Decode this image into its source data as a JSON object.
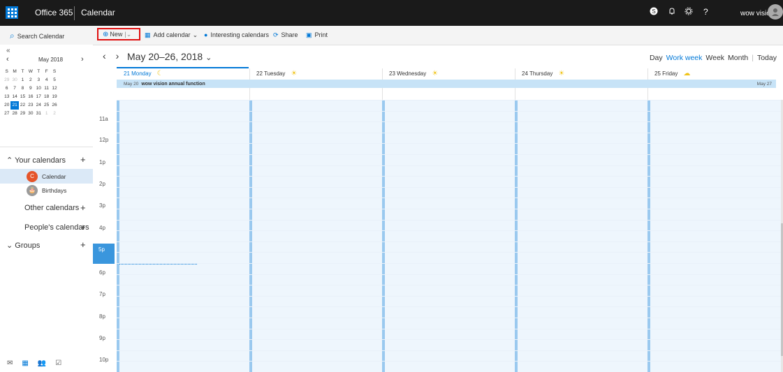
{
  "topbar": {
    "app_name": "Office 365",
    "module_name": "Calendar",
    "icons": [
      "skype-icon",
      "bell-icon",
      "gear-icon",
      "help-icon"
    ],
    "help_glyph": "?",
    "username": "wow vision"
  },
  "commands": {
    "search_label": "Search Calendar",
    "new_label": "New",
    "add_calendar_label": "Add calendar",
    "interesting_label": "Interesting calendars",
    "share_label": "Share",
    "print_label": "Print"
  },
  "mini_calendar": {
    "month_label": "May 2018",
    "day_headers": [
      "S",
      "M",
      "T",
      "W",
      "T",
      "F",
      "S"
    ],
    "weeks": [
      [
        "29",
        "30",
        "1",
        "2",
        "3",
        "4",
        "5"
      ],
      [
        "6",
        "7",
        "8",
        "9",
        "10",
        "11",
        "12"
      ],
      [
        "13",
        "14",
        "15",
        "16",
        "17",
        "18",
        "19"
      ],
      [
        "20",
        "21",
        "22",
        "23",
        "24",
        "25",
        "26"
      ],
      [
        "27",
        "28",
        "29",
        "30",
        "31",
        "1",
        "2"
      ]
    ],
    "selected": "21"
  },
  "left_pane": {
    "your_calendars": "Your calendars",
    "calendars": [
      {
        "badge": "C",
        "label": "Calendar",
        "color": "#e5542a"
      },
      {
        "badge": "🎂",
        "label": "Birthdays",
        "color": "#9b9b9b"
      }
    ],
    "other_calendars": "Other calendars",
    "peoples_calendars": "People's calendars",
    "groups": "Groups"
  },
  "main": {
    "date_range": "May 20–26, 2018",
    "views": [
      "Day",
      "Work week",
      "Week",
      "Month",
      "Today"
    ],
    "active_view": "Work week",
    "days": [
      {
        "label": "21 Monday",
        "weather": "☾"
      },
      {
        "label": "22 Tuesday",
        "weather": "☀"
      },
      {
        "label": "23 Wednesday",
        "weather": "☀"
      },
      {
        "label": "24 Thursday",
        "weather": "☀"
      },
      {
        "label": "25 Friday",
        "weather": "☁"
      }
    ],
    "event": {
      "start": "May 20",
      "title": "wow vision annual function",
      "end": "May 27"
    },
    "time_labels": [
      "11a",
      "12p",
      "1p",
      "2p",
      "3p",
      "4p",
      "5p",
      "6p",
      "7p",
      "8p",
      "9p",
      "10p"
    ],
    "current_hour": "5p"
  },
  "colors": {
    "accent": "#0078d7",
    "topbar": "#1a1a1a",
    "event_bg": "#c7e3f7",
    "highlight_box": "#e01010"
  }
}
